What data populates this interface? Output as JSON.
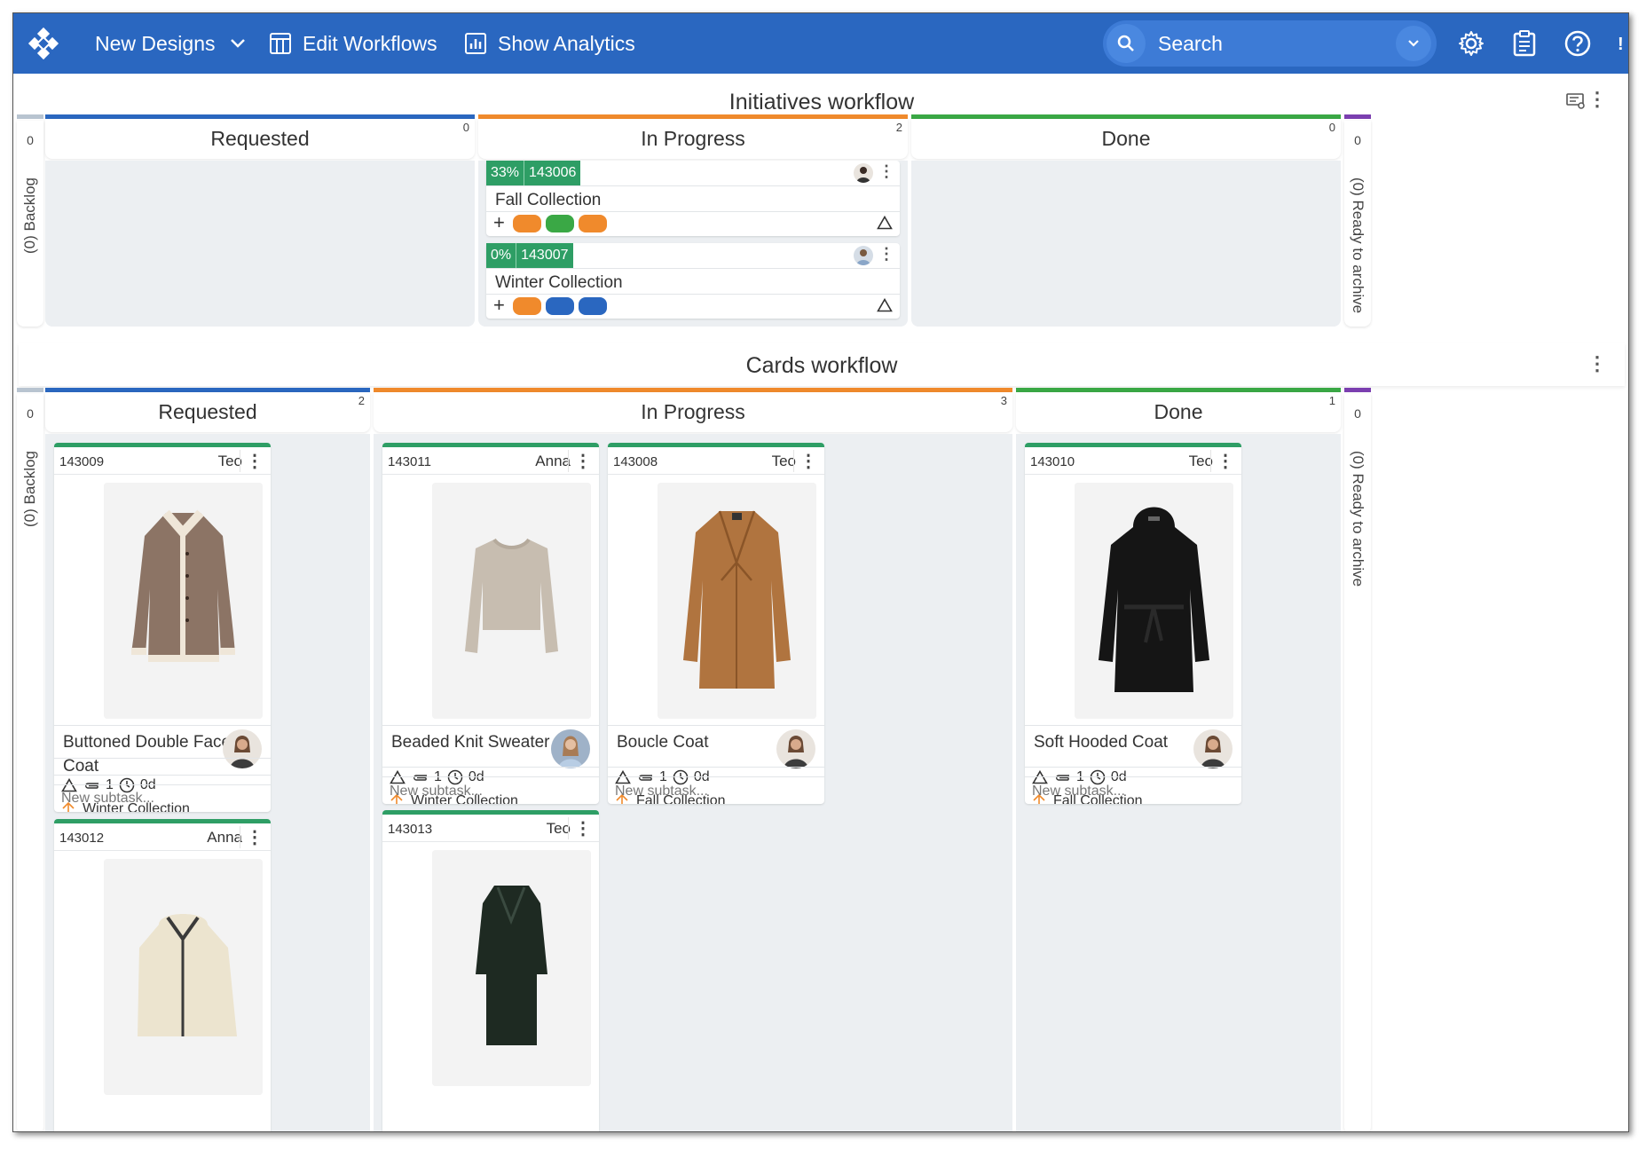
{
  "header": {
    "board_menu": "New Designs",
    "edit_workflows": "Edit Workflows",
    "show_analytics": "Show Analytics",
    "search_placeholder": "Search"
  },
  "initiatives": {
    "title": "Initiatives workflow",
    "backlog_count": "0",
    "backlog_label": "(0) Backlog",
    "archive_count": "0",
    "archive_label": "(0) Ready to archive",
    "columns": [
      {
        "name": "Requested",
        "count": "0",
        "color": "#2a67c0"
      },
      {
        "name": "In Progress",
        "count": "2",
        "color": "#f08a2c"
      },
      {
        "name": "Done",
        "count": "0",
        "color": "#3aa845"
      }
    ],
    "cards": [
      {
        "progress": "33%",
        "id": "143006",
        "name": "Fall Collection",
        "add": "+",
        "pills": [
          "#f08a2c",
          "#3aa845",
          "#f08a2c"
        ]
      },
      {
        "progress": "0%",
        "id": "143007",
        "name": "Winter Collection",
        "add": "+",
        "pills": [
          "#f08a2c",
          "#2a67c0",
          "#2a67c0"
        ]
      }
    ]
  },
  "cards_workflow": {
    "title": "Cards workflow",
    "backlog_count": "0",
    "backlog_label": "(0) Backlog",
    "archive_count": "0",
    "archive_label": "(0) Ready to archive",
    "columns": [
      {
        "name": "Requested",
        "count": "2",
        "color": "#2a67c0"
      },
      {
        "name": "In Progress",
        "count": "3",
        "color": "#f08a2c"
      },
      {
        "name": "Done",
        "count": "1",
        "color": "#3aa845"
      }
    ],
    "cards": [
      {
        "id": "143009",
        "user": "Teo",
        "title_line1": "Buttoned Double Faced",
        "title_line2": "Coat",
        "attachments": "1",
        "time": "0d",
        "parent": "Winter Collection",
        "subtask": "New subtask...",
        "garment": "shearling-coat"
      },
      {
        "id": "143012",
        "user": "Anna",
        "garment": "fleece-jacket"
      },
      {
        "id": "143011",
        "user": "Anna",
        "title_line1": "Beaded Knit Sweater",
        "attachments": "1",
        "time": "0d",
        "parent": "Winter Collection",
        "subtask": "New subtask...",
        "garment": "knit-sweater"
      },
      {
        "id": "143013",
        "user": "Teo",
        "garment": "velvet-dress"
      },
      {
        "id": "143008",
        "user": "Teo",
        "title_line1": "Boucle Coat",
        "attachments": "1",
        "time": "0d",
        "parent": "Fall Collection",
        "subtask": "New subtask...",
        "garment": "camel-coat"
      },
      {
        "id": "143010",
        "user": "Teo",
        "title_line1": "Soft Hooded Coat",
        "attachments": "1",
        "time": "0d",
        "parent": "Fall Collection",
        "subtask": "New subtask...",
        "garment": "black-hooded-coat"
      }
    ]
  },
  "colors": {
    "brand": "#2a67c0",
    "badge": "#2e9e65",
    "orange": "#f08a2c",
    "green": "#3aa845",
    "purple": "#7b3fb0"
  }
}
